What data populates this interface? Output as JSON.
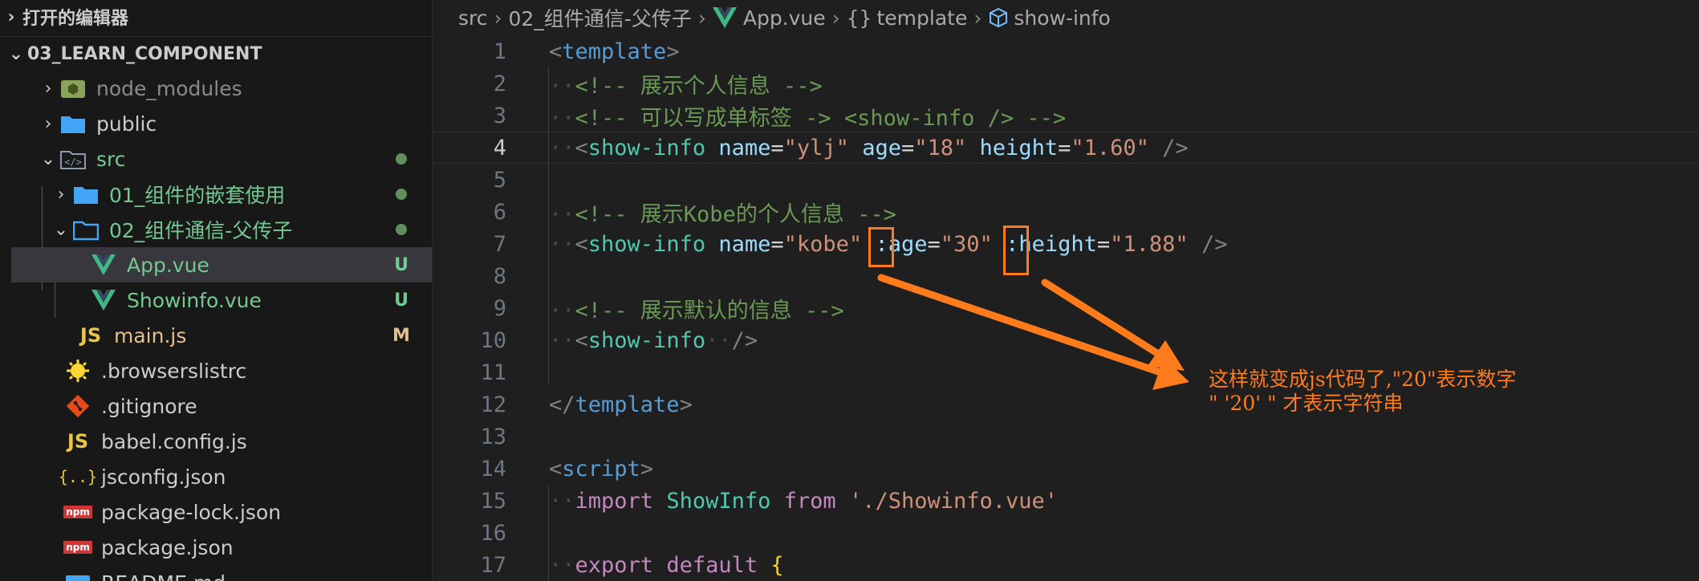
{
  "sidebar": {
    "open_editors_title": "打开的编辑器",
    "project_title": "03_LEARN_COMPONENT",
    "items": [
      {
        "label": "node_modules",
        "color": "#8b8b8b",
        "badge": ""
      },
      {
        "label": "public",
        "color": "#cccccc",
        "badge": ""
      },
      {
        "label": "src",
        "color": "#73c991",
        "badge": "dot"
      },
      {
        "label": "01_组件的嵌套使用",
        "color": "#73c991",
        "badge": "dot"
      },
      {
        "label": "02_组件通信-父传子",
        "color": "#73c991",
        "badge": "dot"
      },
      {
        "label": "App.vue",
        "color": "#73c991",
        "badge": "U"
      },
      {
        "label": "Showinfo.vue",
        "color": "#73c991",
        "badge": "U"
      },
      {
        "label": "main.js",
        "color": "#e2c08d",
        "badge": "M"
      },
      {
        "label": ".browserslistrc",
        "color": "#cccccc",
        "badge": ""
      },
      {
        "label": ".gitignore",
        "color": "#cccccc",
        "badge": ""
      },
      {
        "label": "babel.config.js",
        "color": "#cccccc",
        "badge": ""
      },
      {
        "label": "jsconfig.json",
        "color": "#cccccc",
        "badge": ""
      },
      {
        "label": "package-lock.json",
        "color": "#cccccc",
        "badge": ""
      },
      {
        "label": "package.json",
        "color": "#cccccc",
        "badge": ""
      },
      {
        "label": "README.md",
        "color": "#cccccc",
        "badge": ""
      }
    ],
    "js_icon_text": "JS",
    "npm_icon_text": "npm"
  },
  "breadcrumb": {
    "parts": [
      "src",
      "02_组件通信-父传子",
      "App.vue",
      "template",
      "show-info"
    ]
  },
  "code": {
    "line_numbers": [
      "1",
      "2",
      "3",
      "4",
      "5",
      "6",
      "7",
      "8",
      "9",
      "10",
      "11",
      "12",
      "13",
      "14",
      "15",
      "16",
      "17"
    ],
    "l1_open": "<",
    "l1_tag": "template",
    "l1_close": ">",
    "l2_comment": "<!-- 展示个人信息 -->",
    "l3_comment": "<!-- 可以写成单标签 -> <show-info /> -->",
    "l4": {
      "tag": "show-info",
      "a1": "name",
      "v1": "\"ylj\"",
      "a2": "age",
      "v2": "\"18\"",
      "a3": "height",
      "v3": "\"1.60\""
    },
    "l6_comment": "<!-- 展示Kobe的个人信息 -->",
    "l7": {
      "tag": "show-info",
      "a1": "name",
      "v1": "\"kobe\"",
      "a2": ":age",
      "v2": "\"30\"",
      "a3": ":height",
      "v3": "\"1.88\""
    },
    "l9_comment": "<!-- 展示默认的信息 -->",
    "l10_tag": "show-info",
    "l12_tag": "template",
    "l14_tag": "script",
    "l15": {
      "kw1": "import",
      "cls": "ShowInfo",
      "kw2": "from",
      "str": "'./Showinfo.vue'"
    },
    "l17": {
      "kw1": "export",
      "kw2": "default",
      "brace": "{"
    },
    "eq": "=",
    "lt": "<",
    "gt": ">",
    "selfclose": "/>",
    "close_open": "</"
  },
  "annotation": {
    "line1": "这样就变成js代码了,\"20\"表示数字",
    "line2": "\" '20' \" 才表示字符串",
    "color": "#ff7b1c"
  }
}
